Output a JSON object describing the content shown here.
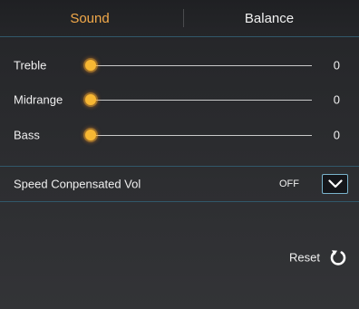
{
  "tabs": {
    "sound": "Sound",
    "balance": "Balance"
  },
  "eq": {
    "treble": {
      "label": "Treble",
      "value": "0"
    },
    "midrange": {
      "label": "Midrange",
      "value": "0"
    },
    "bass": {
      "label": "Bass",
      "value": "0"
    }
  },
  "speed_compensated": {
    "label": "Speed Conpensated Vol",
    "value": "OFF"
  },
  "reset": {
    "label": "Reset"
  },
  "colors": {
    "accent": "#f2a94a",
    "divider": "#31586a",
    "dropdown_border": "#7ab3cc"
  },
  "icons": {
    "dropdown": "chevron-down-icon",
    "reset": "refresh-icon"
  }
}
